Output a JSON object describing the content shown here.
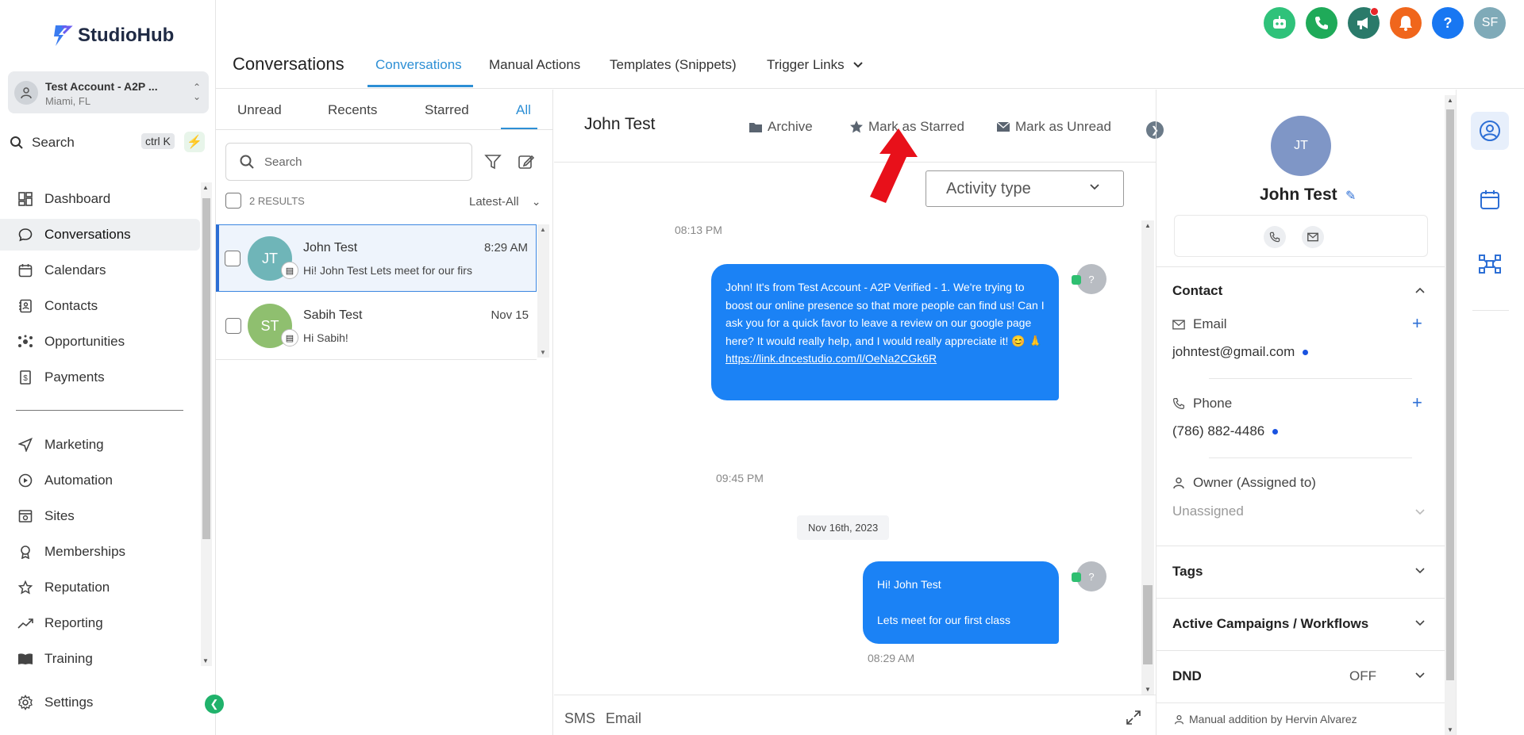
{
  "brand": {
    "name": "StudioHub"
  },
  "account": {
    "name": "Test Account - A2P ...",
    "location": "Miami, FL"
  },
  "side_search": {
    "label": "Search",
    "shortcut": "ctrl K"
  },
  "nav": {
    "dashboard": "Dashboard",
    "conversations": "Conversations",
    "calendars": "Calendars",
    "contacts": "Contacts",
    "opportunities": "Opportunities",
    "payments": "Payments",
    "marketing": "Marketing",
    "automation": "Automation",
    "sites": "Sites",
    "memberships": "Memberships",
    "reputation": "Reputation",
    "reporting": "Reporting",
    "training": "Training",
    "settings": "Settings"
  },
  "header": {
    "title": "Conversations",
    "tabs": [
      "Conversations",
      "Manual Actions",
      "Templates (Snippets)",
      "Trigger Links"
    ],
    "user_initials": "SF",
    "help": "?"
  },
  "list": {
    "filters": [
      "Unread",
      "Recents",
      "Starred",
      "All"
    ],
    "search_placeholder": "Search",
    "results": "2 RESULTS",
    "sort": "Latest-All",
    "items": [
      {
        "initials": "JT",
        "name": "John Test",
        "time": "8:29 AM",
        "preview": "Hi! John Test Lets meet for our firs",
        "color": "#6fb5b8"
      },
      {
        "initials": "ST",
        "name": "Sabih Test",
        "time": "Nov 15",
        "preview": "Hi Sabih!",
        "color": "#8fbf6f"
      }
    ]
  },
  "chat": {
    "name": "John Test",
    "actions": {
      "archive": "Archive",
      "star": "Mark as Starred",
      "unread": "Mark as Unread"
    },
    "activity_placeholder": "Activity type",
    "stamp1": "08:13 PM",
    "msg1_text": "John! It's  from Test Account - A2P Verified - 1. We're trying to boost our online presence so that more people can find us! Can I ask you for a quick favor to leave a review on our google page here? It would really help, and I would really appreciate it! 😊 🙏",
    "msg1_link": "https://link.dncestudio.com/l/OeNa2CGk6R",
    "stamp2": "09:45 PM",
    "date_divider": "Nov 16th, 2023",
    "msg2_line1": "Hi! John Test",
    "msg2_line2": "Lets meet for our first class",
    "stamp3": "08:29 AM",
    "avatar_q": "?",
    "compose_tabs": [
      "SMS",
      "Email"
    ]
  },
  "contact": {
    "initials": "JT",
    "name": "John Test",
    "section_contact": "Contact",
    "email_label": "Email",
    "email": "johntest@gmail.com",
    "phone_label": "Phone",
    "phone": "(786) 882-4486",
    "owner_label": "Owner (Assigned to)",
    "owner": "Unassigned",
    "tags": "Tags",
    "campaigns": "Active Campaigns / Workflows",
    "dnd": "DND",
    "dnd_value": "OFF",
    "footer": "Manual addition by Hervin Alvarez"
  },
  "colors": {
    "accent": "#2d8fd5",
    "bubble": "#1b82f5",
    "brand_green": "#20b26b",
    "arrow": "#e8101a"
  }
}
